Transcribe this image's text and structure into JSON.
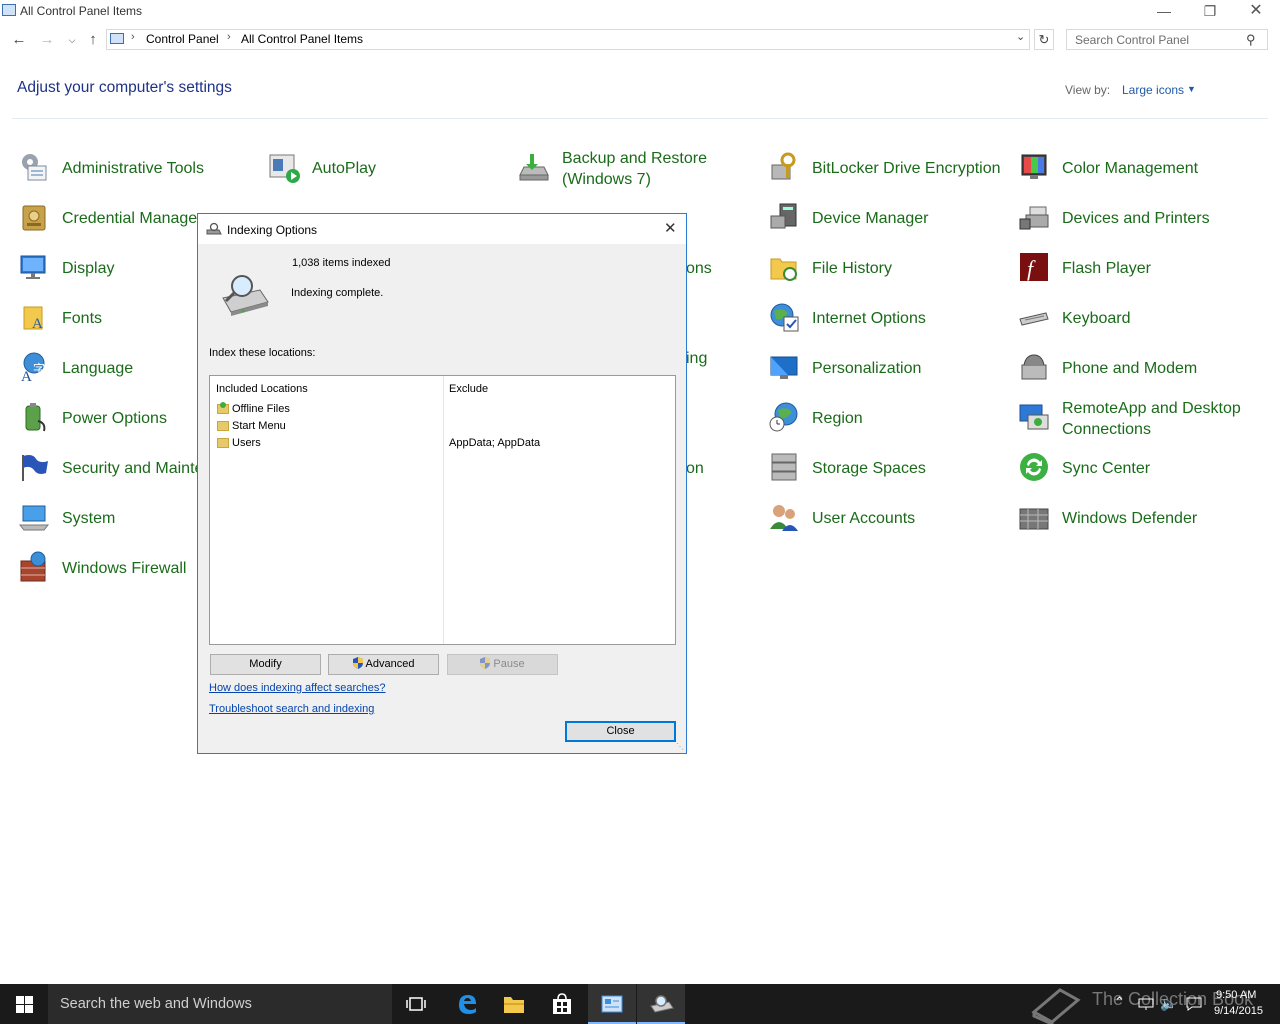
{
  "window": {
    "title": "All Control Panel Items"
  },
  "address": {
    "crumbs": [
      "Control Panel",
      "All Control Panel Items"
    ]
  },
  "search": {
    "placeholder": "Search Control Panel"
  },
  "header": {
    "heading": "Adjust your computer's settings",
    "view_by_label": "View by:",
    "view_by_value": "Large icons"
  },
  "items": {
    "col1": [
      "Administrative Tools",
      "Credential Manager",
      "Display",
      "Fonts",
      "Language",
      "Power Options",
      "Security and Maintenance",
      "System",
      "Windows Firewall"
    ],
    "col2": [
      "AutoPlay"
    ],
    "col3": [
      "Backup and Restore",
      "(Windows 7)"
    ],
    "col3_partials": [
      "ons",
      "ing",
      "on"
    ],
    "col4": [
      "BitLocker Drive Encryption",
      "Device Manager",
      "File History",
      "Internet Options",
      "Personalization",
      "Region",
      "Storage Spaces",
      "User Accounts"
    ],
    "col5": [
      "Color Management",
      "Devices and Printers",
      "Flash Player",
      "Keyboard",
      "Phone and Modem",
      "RemoteApp and Desktop",
      "Connections",
      "Sync Center",
      "Windows Defender"
    ]
  },
  "dialog": {
    "title": "Indexing Options",
    "items_indexed": "1,038 items indexed",
    "status": "Indexing complete.",
    "index_label": "Index these locations:",
    "col_included": "Included Locations",
    "col_exclude": "Exclude",
    "locations": [
      {
        "name": "Offline Files",
        "exclude": ""
      },
      {
        "name": "Start Menu",
        "exclude": ""
      },
      {
        "name": "Users",
        "exclude": "AppData; AppData"
      }
    ],
    "buttons": {
      "modify": "Modify",
      "advanced": "Advanced",
      "pause": "Pause",
      "close": "Close"
    },
    "links": [
      "How does indexing affect searches?",
      "Troubleshoot search and indexing"
    ]
  },
  "taskbar": {
    "search_text": "Search the web and Windows",
    "time": "9:50 AM",
    "date": "9/14/2015",
    "watermark": "The Collection Book"
  },
  "colors": {
    "item_link": "#1a6b1a",
    "heading": "#1e3287",
    "accent": "#2e7bd6",
    "taskbar": "#1a1a1a"
  }
}
